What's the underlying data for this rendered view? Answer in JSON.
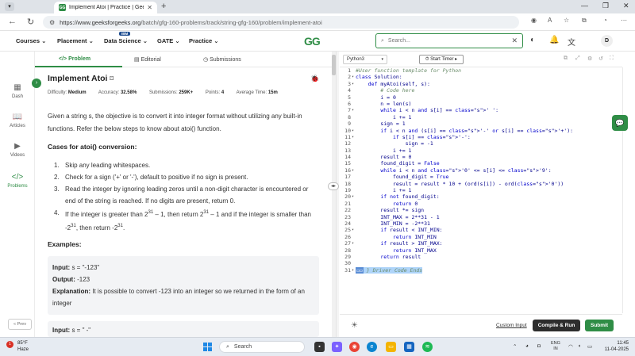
{
  "browser": {
    "tab_title": "Implement Atoi | Practice | Geeksf",
    "tab_favicon": "GG",
    "url_host": "https://www.geeksforgeeks.org",
    "url_path": "/batch/gfg-160-problems/track/string-gfg-160/problem/implement-atoi"
  },
  "header": {
    "menu": [
      "Courses",
      "Placement",
      "Data Science",
      "GATE",
      "Practice"
    ],
    "ibm_badge": "IBM",
    "logo": "GG",
    "search_placeholder": "Search...",
    "avatar_initial": "D",
    "brand_color": "#2f8d46"
  },
  "sidenav": {
    "items": [
      {
        "label": "Dash",
        "icon": "dashboard-icon"
      },
      {
        "label": "Articles",
        "icon": "book-icon"
      },
      {
        "label": "Videos",
        "icon": "video-icon"
      },
      {
        "label": "Problems",
        "icon": "code-icon"
      }
    ],
    "prev_label": "« Prev"
  },
  "problem": {
    "tabs": [
      "Problem",
      "Editorial",
      "Submissions"
    ],
    "title": "Implement Atoi",
    "meta": {
      "difficulty_label": "Difficulty:",
      "difficulty": "Medium",
      "accuracy_label": "Accuracy:",
      "accuracy": "32.58%",
      "submissions_label": "Submissions:",
      "submissions": "259K+",
      "points_label": "Points:",
      "points": "4",
      "time_label": "Average Time:",
      "time": "15m"
    },
    "description": "Given a string s, the objective is to convert it into integer format without utilizing any built-in functions. Refer the below steps to know about atoi() function.",
    "cases_heading": "Cases for atoi() conversion:",
    "steps": [
      "Skip any leading whitespaces.",
      "Check for a sign ('+' or '-'), default to positive if no sign is present.",
      "Read the integer by ignoring leading zeros until a non-digit character is encountered or end of the string is reached. If no digits are present, return 0."
    ],
    "step4": {
      "a": "If the integer is greater than 2",
      "sup1": "31",
      "b": " – 1, then return 2",
      "sup2": "31",
      "c": " – 1 and if the integer is smaller than -2",
      "sup3": "31",
      "d": ", then return -2",
      "sup4": "31",
      "e": "."
    },
    "examples_heading": "Examples:",
    "example1": {
      "input_label": "Input:",
      "input": "s = \"-123\"",
      "output_label": "Output:",
      "output": "-123",
      "explanation_label": "Explanation:",
      "explanation": "It is possible to convert -123 into an integer so we returned in the form of an integer"
    },
    "example2": {
      "input_label": "Input:",
      "input": "s = \"  -\""
    }
  },
  "editor": {
    "language": "Python3",
    "timer_label": "Start Timer",
    "lines": [
      "#User function template for Python",
      "class Solution:",
      "    def myAtoi(self, s):",
      "        # Code here",
      "        i = 0",
      "        n = len(s)",
      "        while i < n and s[i] == ' ':",
      "            i += 1",
      "        sign = 1",
      "        if i < n and (s[i] == '-' or s[i] == '+'):",
      "            if s[i] == '-':",
      "                sign = -1",
      "            i += 1",
      "        result = 0",
      "        found_digit = False",
      "        while i < n and '0' <= s[i] <= '9':",
      "            found_digit = True",
      "            result = result * 10 + (ord(s[i]) - ord('0'))",
      "            i += 1",
      "        if not found_digit:",
      "            return 0",
      "        result *= sign",
      "        INT_MAX = 2**31 - 1",
      "        INT_MIN = -2**31",
      "        if result < INT_MIN:",
      "            return INT_MIN",
      "        if result > INT_MAX:",
      "            return INT_MAX",
      "        return result",
      "",
      "} Driver Code Ends"
    ],
    "custom_input": "Custom Input",
    "compile_run": "Compile & Run",
    "submit": "Submit"
  },
  "taskbar": {
    "weather_badge": "1",
    "temp": "85°F",
    "condition": "Haze",
    "search_placeholder": "Search",
    "lang1": "ENG",
    "lang2": "IN",
    "time": "11:45",
    "date": "11-04-2025"
  }
}
